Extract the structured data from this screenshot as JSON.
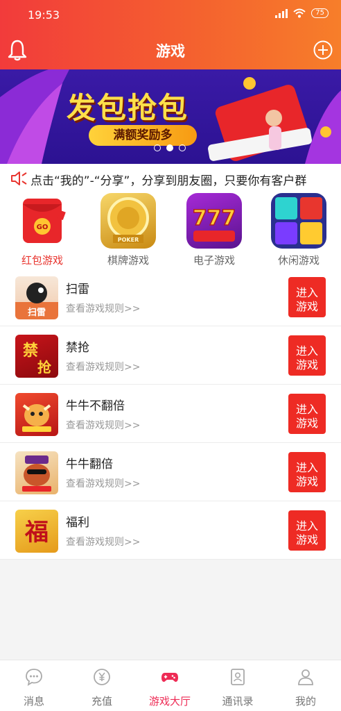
{
  "status_bar": {
    "time": "19:53",
    "battery": "75"
  },
  "header": {
    "title": "游戏"
  },
  "banner": {
    "title": "发包抢包",
    "subtitle": "满额奖励多"
  },
  "notice": {
    "text": "点击“我的”-“分享”，分享到朋友圈，只要你有客户群"
  },
  "categories": [
    {
      "label": "红包游戏",
      "icon": "red-envelope-go",
      "active": true
    },
    {
      "label": "棋牌游戏",
      "icon": "poker-chip"
    },
    {
      "label": "电子游戏",
      "icon": "slot-777"
    },
    {
      "label": "休闲游戏",
      "icon": "gem-blocks"
    }
  ],
  "games": [
    {
      "name": "扫雷",
      "thumb_text": "扫雷",
      "rule": "查看游戏规则>>",
      "button": "进入\n游戏"
    },
    {
      "name": "禁抢",
      "thumb_text": "禁抢",
      "rule": "查看游戏规则>>",
      "button": "进入\n游戏"
    },
    {
      "name": "牛牛不翻倍",
      "thumb_text": "",
      "rule": "查看游戏规则>>",
      "button": "进入\n游戏"
    },
    {
      "name": "牛牛翻倍",
      "thumb_text": "",
      "rule": "查看游戏规则>>",
      "button": "进入\n游戏"
    },
    {
      "name": "福利",
      "thumb_text": "福",
      "rule": "查看游戏规则>>",
      "button": "进入\n游戏"
    }
  ],
  "tabbar": [
    {
      "label": "消息",
      "icon": "chat-bubble-icon"
    },
    {
      "label": "充值",
      "icon": "yuan-coin-icon"
    },
    {
      "label": "游戏大厅",
      "icon": "gamepad-icon",
      "active": true
    },
    {
      "label": "通讯录",
      "icon": "contacts-icon"
    },
    {
      "label": "我的",
      "icon": "person-icon"
    }
  ],
  "colors": {
    "accent": "#ee2b24",
    "tab_active": "#ee2b55",
    "header_start": "#f23b3b",
    "header_end": "#f77e2a"
  }
}
